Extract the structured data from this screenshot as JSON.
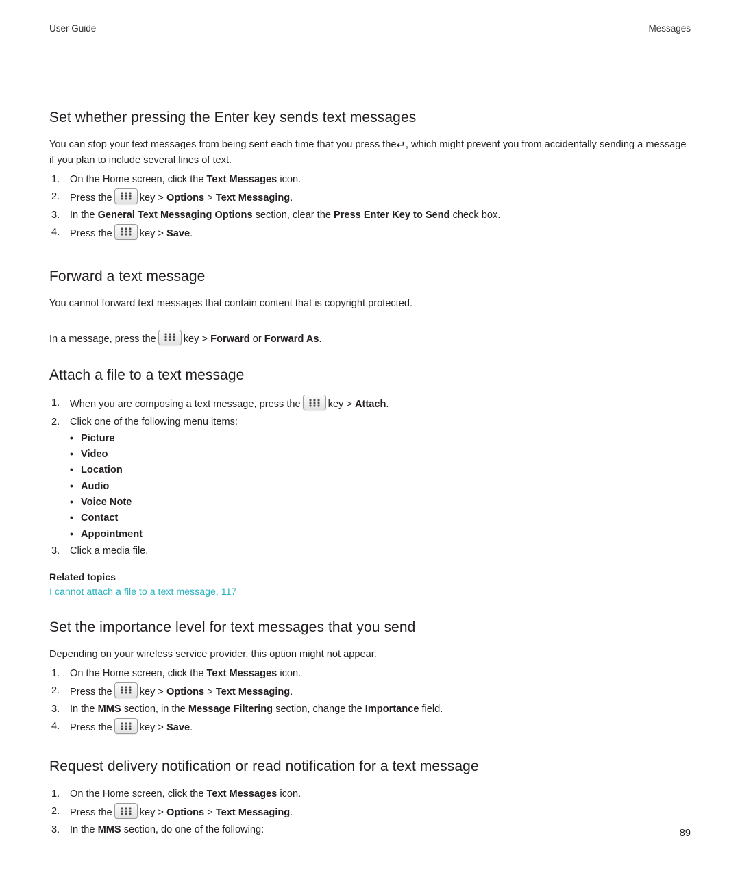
{
  "header": {
    "left": "User Guide",
    "right": "Messages"
  },
  "page_number": "89",
  "sections": [
    {
      "title": "Set whether pressing the Enter key sends text messages",
      "intro_part1": "You can stop your text messages from being sent each time that you press the",
      "intro_part2": ", which might prevent you from accidentally sending a message if you plan to include several lines of text.",
      "steps": [
        {
          "num": "1.",
          "text_before": "On the Home screen, click the ",
          "bold1": "Text Messages",
          "text_after": " icon."
        },
        {
          "num": "2.",
          "pre": "Press the",
          "post_key": "key >",
          "bold1": "Options",
          "sep": ">",
          "bold2": "Text Messaging",
          "end": "."
        },
        {
          "num": "3.",
          "t1": "In the ",
          "b1": "General Text Messaging Options",
          "t2": " section, clear the ",
          "b2": "Press Enter Key to Send",
          "t3": " check box."
        },
        {
          "num": "4.",
          "pre": "Press the",
          "post_key": "key >",
          "bold1": "Save",
          "end": "."
        }
      ]
    },
    {
      "title": "Forward a text message",
      "intro": "You cannot forward text messages that contain content that is copyright protected.",
      "instruction": {
        "t1": "In a message, press the",
        "t2": "key >",
        "b1": "Forward",
        "t3": "or",
        "b2": "Forward As",
        "t4": "."
      }
    },
    {
      "title": "Attach a file to a text message",
      "steps": [
        {
          "num": "1.",
          "t1": "When you are composing a text message, press the",
          "t2": "key >",
          "b1": "Attach",
          "t3": "."
        },
        {
          "num": "2.",
          "t1": "Click one of the following menu items:"
        },
        {
          "num": "3.",
          "t1": "Click a media file."
        }
      ],
      "menu_items": [
        "Picture",
        "Video",
        "Location",
        "Audio",
        "Voice Note",
        "Contact",
        "Appointment"
      ],
      "related_topics_label": "Related topics",
      "related_links": [
        "I cannot attach a file to a text message, 117"
      ]
    },
    {
      "title": "Set the importance level for text messages that you send",
      "intro": "Depending on your wireless service provider, this option might not appear.",
      "steps": [
        {
          "num": "1.",
          "text_before": "On the Home screen, click the ",
          "bold1": "Text Messages",
          "text_after": " icon."
        },
        {
          "num": "2.",
          "pre": "Press the",
          "post_key": "key >",
          "bold1": "Options",
          "sep": ">",
          "bold2": "Text Messaging",
          "end": "."
        },
        {
          "num": "3.",
          "t1": "In the ",
          "b1": "MMS",
          "t2": " section, in the ",
          "b2": "Message Filtering",
          "t3": " section, change the ",
          "b3": "Importance",
          "t4": " field."
        },
        {
          "num": "4.",
          "pre": "Press the",
          "post_key": "key >",
          "bold1": "Save",
          "end": "."
        }
      ]
    },
    {
      "title": "Request delivery notification or read notification for a text message",
      "steps": [
        {
          "num": "1.",
          "text_before": "On the Home screen, click the ",
          "bold1": "Text Messages",
          "text_after": " icon."
        },
        {
          "num": "2.",
          "pre": "Press the",
          "post_key": "key >",
          "bold1": "Options",
          "sep": ">",
          "bold2": "Text Messaging",
          "end": "."
        },
        {
          "num": "3.",
          "t1": "In the ",
          "b1": "MMS",
          "t2": " section, do one of the following:"
        }
      ]
    }
  ],
  "glyphs": {
    "menu_key": "blackberry-menu-key",
    "enter_key": "↵"
  },
  "colors": {
    "text": "#231f20",
    "link": "#2bb3c0"
  }
}
